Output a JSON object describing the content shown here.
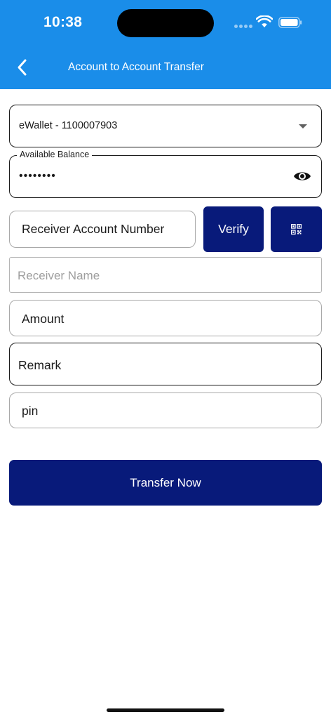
{
  "status_bar": {
    "time": "10:38"
  },
  "header": {
    "title": "Account to Account Transfer",
    "back_icon": "chevron-left-icon",
    "background_color": "#1a8de9"
  },
  "form": {
    "wallet_select": {
      "value": "eWallet - 1100007903",
      "icon": "caret-down-icon"
    },
    "available_balance": {
      "label": "Available Balance",
      "value": "••••••••",
      "icon": "eye-icon"
    },
    "receiver_account": {
      "placeholder": "Receiver Account Number"
    },
    "verify_button": {
      "label": "Verify"
    },
    "qr_button": {
      "icon": "qr-code-icon"
    },
    "receiver_name": {
      "placeholder": "Receiver Name"
    },
    "amount": {
      "placeholder": "Amount"
    },
    "remark": {
      "placeholder": "Remark"
    },
    "pin": {
      "placeholder": "pin"
    }
  },
  "transfer_button": {
    "label": "Transfer Now",
    "color": "#081a7a"
  }
}
